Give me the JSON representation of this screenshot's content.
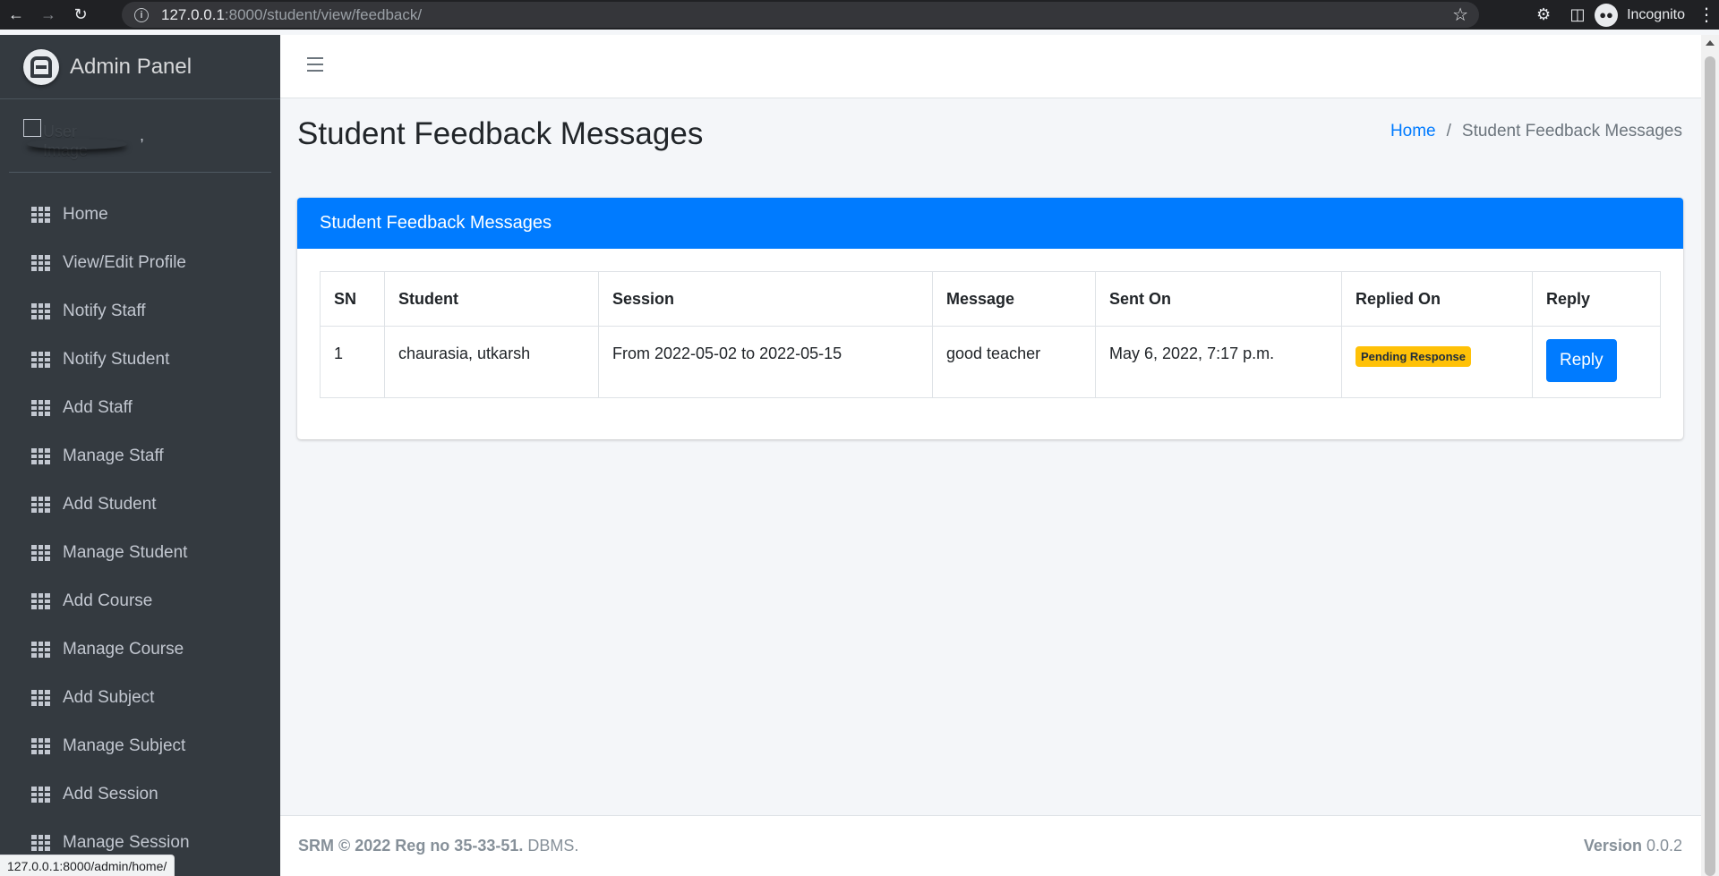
{
  "browser": {
    "url_host": "127.0.0.1",
    "url_rest": ":8000/student/view/feedback/",
    "profile_label": "Incognito",
    "status_url": "127.0.0.1:8000/admin/home/"
  },
  "sidebar": {
    "brand": "Admin Panel",
    "user_image_alt": "User Image",
    "user_name": ",",
    "items": [
      {
        "label": "Home"
      },
      {
        "label": "View/Edit Profile"
      },
      {
        "label": "Notify Staff"
      },
      {
        "label": "Notify Student"
      },
      {
        "label": "Add Staff"
      },
      {
        "label": "Manage Staff"
      },
      {
        "label": "Add Student"
      },
      {
        "label": "Manage Student"
      },
      {
        "label": "Add Course"
      },
      {
        "label": "Manage Course"
      },
      {
        "label": "Add Subject"
      },
      {
        "label": "Manage Subject"
      },
      {
        "label": "Add Session"
      },
      {
        "label": "Manage Session"
      }
    ]
  },
  "header": {
    "page_title": "Student Feedback Messages",
    "breadcrumb_home": "Home",
    "breadcrumb_sep": "/",
    "breadcrumb_current": "Student Feedback Messages"
  },
  "card": {
    "title": "Student Feedback Messages",
    "columns": [
      "SN",
      "Student",
      "Session",
      "Message",
      "Sent On",
      "Replied On",
      "Reply"
    ],
    "rows": [
      {
        "sn": "1",
        "student": "chaurasia, utkarsh",
        "session": "From 2022-05-02 to 2022-05-15",
        "message": "good teacher",
        "sent_on": "May 6, 2022, 7:17 p.m.",
        "replied_on": "Pending Response",
        "reply_label": "Reply"
      }
    ]
  },
  "footer": {
    "left_bold": "SRM © 2022 Reg no 35-33-51.",
    "left_rest": "DBMS.",
    "version_label": "Version",
    "version_value": "0.0.2"
  },
  "colors": {
    "sidebar_bg": "#343a40",
    "primary": "#007bff",
    "warning": "#ffc107"
  }
}
